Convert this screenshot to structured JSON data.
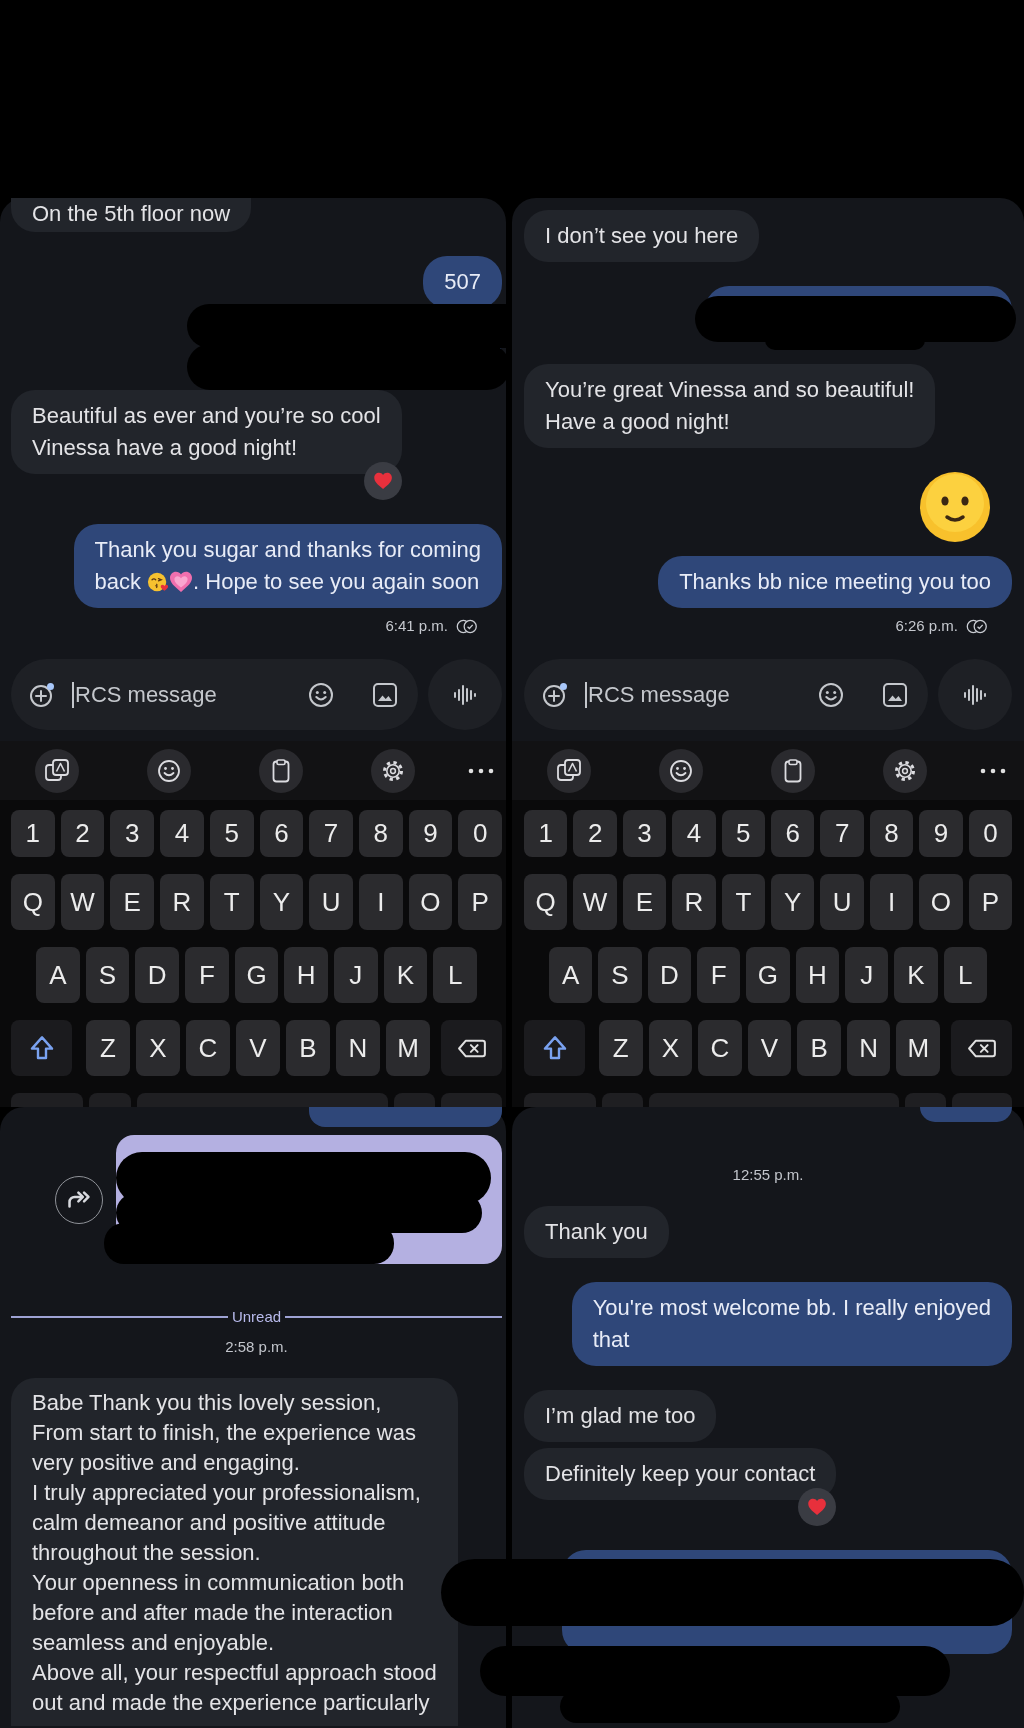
{
  "panels": [
    {
      "messages": [
        {
          "kind": "received",
          "text": "On the 5th floor now",
          "reacted": false
        },
        {
          "kind": "sent",
          "text": "507",
          "reacted": false
        },
        {
          "kind": "redacted"
        },
        {
          "kind": "received",
          "text": "Beautiful as ever and you’re so cool\nVinessa have a good night!",
          "reacted": true
        },
        {
          "kind": "sent",
          "lines": [
            [
              {
                "kind": "text",
                "text": "Thank you sugar and thanks for coming"
              }
            ],
            [
              {
                "kind": "text",
                "text": "back"
              },
              {
                "kind": "kiss"
              },
              {
                "kind": "heart"
              },
              {
                "kind": "text",
                "text": ". Hope to see you again soon"
              }
            ]
          ],
          "reacted": false
        },
        {
          "kind": "status",
          "time": "6:41 p.m."
        }
      ],
      "composer": {
        "placeholder": "RCS message"
      },
      "keyboard": {
        "rows": [
          {
            "kind": "numbers",
            "keys": [
              "1",
              "2",
              "3",
              "4",
              "5",
              "6",
              "7",
              "8",
              "9",
              "0"
            ]
          },
          {
            "kind": "letters",
            "keys": [
              "Q",
              "W",
              "E",
              "R",
              "T",
              "Y",
              "U",
              "I",
              "O",
              "P"
            ]
          },
          {
            "kind": "letters_inset",
            "keys": [
              "A",
              "S",
              "D",
              "F",
              "G",
              "H",
              "J",
              "K",
              "L"
            ]
          },
          {
            "kind": "shift",
            "keys": [
              "Z",
              "X",
              "C",
              "V",
              "B",
              "N",
              "M"
            ]
          }
        ]
      }
    },
    {
      "messages": [
        {
          "kind": "received",
          "text": "I don’t see you here",
          "reacted": false
        },
        {
          "kind": "redacted"
        },
        {
          "kind": "received",
          "text": "You’re great Vinessa and so beautiful!\nHave a good night!",
          "reacted": false
        },
        {
          "kind": "emoji"
        },
        {
          "kind": "sent",
          "text": "Thanks bb nice meeting you too",
          "reacted": false
        },
        {
          "kind": "status",
          "time": "6:26 p.m."
        }
      ],
      "composer": {
        "placeholder": "RCS message"
      },
      "keyboard": {
        "rows": [
          {
            "kind": "numbers",
            "keys": [
              "1",
              "2",
              "3",
              "4",
              "5",
              "6",
              "7",
              "8",
              "9",
              "0"
            ]
          },
          {
            "kind": "letters",
            "keys": [
              "Q",
              "W",
              "E",
              "R",
              "T",
              "Y",
              "U",
              "I",
              "O",
              "P"
            ]
          },
          {
            "kind": "letters_inset",
            "keys": [
              "A",
              "S",
              "D",
              "F",
              "G",
              "H",
              "J",
              "K",
              "L"
            ]
          },
          {
            "kind": "shift",
            "keys": [
              "Z",
              "X",
              "C",
              "V",
              "B",
              "N",
              "M"
            ]
          }
        ]
      }
    },
    {
      "messages": [
        {
          "kind": "partial"
        },
        {
          "kind": "forwarded_redacted"
        },
        {
          "kind": "unread",
          "label": "Unread"
        },
        {
          "kind": "timestamp",
          "time": "2:58 p.m."
        },
        {
          "kind": "received",
          "text": "Babe Thank you this lovely session,\nFrom start to finish, the experience was\nvery positive and engaging.\nI truly appreciated your professionalism,\ncalm demeanor and positive attitude\nthroughout the session.\nYour openness in communication both\nbefore and after made the interaction\nseamless and enjoyable.\nAbove all, your respectful approach stood\nout and made the experience particularly",
          "reacted": false
        }
      ]
    },
    {
      "messages": [
        {
          "kind": "partial"
        },
        {
          "kind": "timestamp",
          "time": "12:55 p.m."
        },
        {
          "kind": "received",
          "text": "Thank you",
          "reacted": false
        },
        {
          "kind": "sent",
          "text": "You're most welcome bb. I really enjoyed\nthat",
          "reacted": false
        },
        {
          "kind": "received",
          "text": "I’m glad me too",
          "reacted": false
        },
        {
          "kind": "received",
          "text": "Definitely keep your contact",
          "reacted": true
        },
        {
          "kind": "redacted"
        }
      ]
    }
  ]
}
